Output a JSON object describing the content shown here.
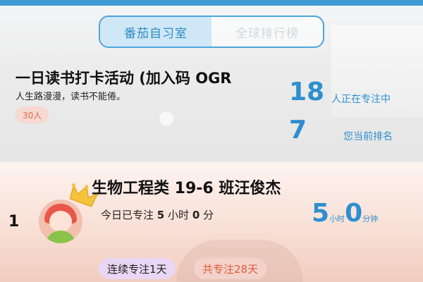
{
  "tabs": {
    "active": "番茄自习室",
    "inactive": "全球排行榜"
  },
  "room": {
    "title": "一日读书打卡活动 (加入码 OGR",
    "description": "人生路漫漫，读书不能倦。",
    "people_badge": "30人"
  },
  "stats": {
    "focusing_count": "18",
    "focusing_label": "人正在专注中",
    "rank_value": "7",
    "rank_label": "您当前排名"
  },
  "leader": {
    "rank": "1",
    "name": "生物工程类 19-6 班汪俊杰",
    "today_prefix": "今日已专注",
    "today_hours": "5",
    "today_hours_unit": "小时",
    "today_minutes": "0",
    "today_minutes_unit": "分",
    "time_hours": "5",
    "time_hours_unit": "小时",
    "time_minutes": "0",
    "time_minutes_unit": "分钟",
    "streak_chip": "连续专注1天",
    "total_chip": "共专注28天"
  },
  "colors": {
    "accent": "#2e8fcf",
    "badge_red": "#e06b4a"
  }
}
